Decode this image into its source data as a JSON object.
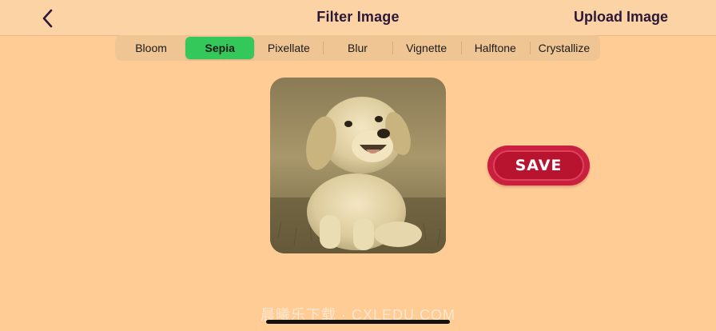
{
  "navbar": {
    "title": "Filter Image",
    "upload_label": "Upload Image",
    "back_icon": "chevron-left-icon"
  },
  "filters": {
    "items": [
      "Bloom",
      "Sepia",
      "Pixellate",
      "Blur",
      "Vignette",
      "Halftone",
      "Crystallize"
    ],
    "selected": "Sepia",
    "selected_color": "#34c759"
  },
  "preview": {
    "subject": "sepia-filtered puppy photo"
  },
  "save_button": {
    "label": "SAVE",
    "color": "#c8203e"
  },
  "watermark": {
    "text": "晨曦乐下载 · CXLEDU.COM"
  },
  "colors": {
    "background": "#ffcc96",
    "navbar": "#fcd3a4",
    "text": "#2b1838"
  }
}
